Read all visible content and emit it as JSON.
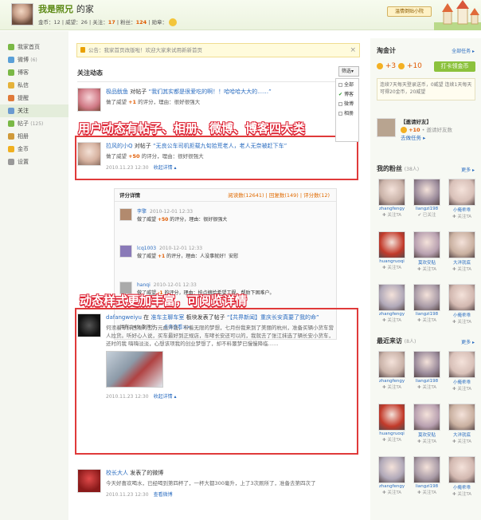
{
  "header": {
    "site_name": "我是照兄",
    "site_suffix": "的家",
    "stats": {
      "gold_label": "金币：",
      "gold": "12",
      "prestige_label": "威望：",
      "prestige": "26",
      "follow_label": "关注：",
      "follow": "17",
      "fans_label": "粉丝：",
      "fans": "124",
      "medal_label": "勋章："
    },
    "new_button": "温情倒贴小院"
  },
  "sidebar": {
    "items": [
      {
        "label": "我家首页",
        "count": "",
        "color": "#7ab846"
      },
      {
        "label": "微博",
        "count": "(6)",
        "color": "#5aa0d8"
      },
      {
        "label": "博客",
        "count": "",
        "color": "#7ab846"
      },
      {
        "label": "私信",
        "count": "",
        "color": "#e5b23a"
      },
      {
        "label": "提醒",
        "count": "",
        "color": "#e07a3a"
      },
      {
        "label": "关注",
        "count": "",
        "color": "#6a9ad0"
      },
      {
        "label": "帖子",
        "count": "(125)",
        "color": "#7ab846"
      },
      {
        "label": "相册",
        "count": "",
        "color": "#d09a3a"
      },
      {
        "label": "金币",
        "count": "",
        "color": "#f0b020"
      },
      {
        "label": "设置",
        "count": "",
        "color": "#999999"
      }
    ]
  },
  "main": {
    "notice": "公告：我家首页改版啦！欢迎大家来试用新新首页",
    "notice_close": "×",
    "section_title": "关注动态",
    "filter": {
      "label": "筛选▾",
      "options": [
        {
          "label": "全部",
          "checked": false
        },
        {
          "label": "博客",
          "checked": true
        },
        {
          "label": "微博",
          "checked": false
        },
        {
          "label": "相册",
          "checked": false
        }
      ]
    },
    "feed": [
      {
        "user": "极品鱿鱼",
        "action": "对帖子",
        "title": "“我们其实都是很爱吃的啊！！哈哈哈大大的……”",
        "sub_pre": "做了威望",
        "score": "+1",
        "sub_post": "的评分，理由：很好很强大"
      },
      {
        "user": "拉风的小Q",
        "action": "对帖子",
        "title": "“无良公车司机拒载九旬拾荒老人，老人无奈被赶下车”",
        "sub_pre": "做了威望",
        "score": "+50",
        "sub_post": "的评分，理由：很好很强大",
        "time": "2010.11.23 12:30",
        "more": "收起详情 ▴"
      }
    ],
    "rating": {
      "title": "评分详情",
      "tabs": "阅读数(12641) | 回复数(149) | 评分数(12)",
      "items": [
        {
          "name": "李擎",
          "time": "2010-12-01 12:33",
          "pre": "做了威望",
          "score": "+50",
          "post": "的评分，理由：很好很强大"
        },
        {
          "name": "lcq1003",
          "time": "2010-12-01 12:33",
          "pre": "做了威望",
          "score": "+1",
          "post": "的评分，理由：人没事就好！安慰"
        },
        {
          "name": "hanqi",
          "time": "2010-12-01 12:33",
          "pre": "做了威望",
          "score": "-1",
          "post": "的评分，理由：拍点摘给希望工程，帮助下困难户。"
        }
      ],
      "footer_pre": "共有 149 条评分，",
      "footer_link": "点击查看>>"
    },
    "post": {
      "user": "dafangweiyu",
      "pre": "在",
      "board": "准车主聊车室",
      "mid": "板块发表了帖子",
      "title": "“【共界新闻】重庆长安真要了我的命”",
      "body": "何须着车抹西凑的五万元血汗钱，带着无限的梦想，七月份我来到了美丽的杭州，准备买辆小货车营人拉货。听好心人说，买车最好到正规店，车哮长安还可以的，我就去了张江抹选了辆长安小货车，还时的我 嗨嗨淡淡，心想该项我的创业梦想了，却不料噩梦已慢慢降临……",
      "time": "2010.11.23 12:30",
      "more": "收起详情 ▴"
    },
    "weibo": {
      "user": "校长大人",
      "action": "发表了的微博",
      "body": "今天好喜欢喝水，已经喝到第四杯了，一杯大都300毫升，上了3次厕所了，准备去第四次了",
      "time": "2010.11.23 12:30",
      "more": "查看微博"
    }
  },
  "annotations": {
    "a1": "用户动态有帖子、相册、微博、博客四大类",
    "a2": "动态样式更加丰富，可阅览详情"
  },
  "right": {
    "coins_title": "淘金计",
    "coins_more": "全部任务 ▸",
    "coin_a": "+3",
    "coin_b": "+10",
    "checkin": "打卡领金币",
    "box1": "连续7天每天登录送币，0威望 连续1天每天可得20金币，20威望",
    "invite_title": "【邀请好友】",
    "invite_reward": "+10",
    "invite_note": "• 邀请好友数",
    "invite_link": "去做任务 ▸",
    "fans_title": "我的粉丝",
    "fans_count": "(38人)",
    "fans_more": "更多 ▸",
    "fans": [
      {
        "n": "zhangfengy",
        "f": "✚ 关注TA"
      },
      {
        "n": "liangzi198",
        "f": "✔ 已关注"
      },
      {
        "n": "小俺乖乖",
        "f": "✚ 关注TA"
      },
      {
        "n": "huangruoqi",
        "f": "✚ 关注TA"
      },
      {
        "n": "莫欢安贴",
        "f": "✚ 关注TA"
      },
      {
        "n": "大洋就底",
        "f": "✚ 关注TA"
      },
      {
        "n": "zhangfengy",
        "f": "✚ 关注TA"
      },
      {
        "n": "liangzi198",
        "f": "✚ 关注TA"
      },
      {
        "n": "小俺乖乖",
        "f": "✚ 关注TA"
      }
    ],
    "visit_title": "最近来访",
    "visit_count": "(8人)",
    "visit_more": "更多 ▸",
    "visitors": [
      {
        "n": "zhangfengy",
        "f": "✚ 关注TA"
      },
      {
        "n": "liangzi198",
        "f": "✚ 关注TA"
      },
      {
        "n": "小俺乖乖",
        "f": "✚ 关注TA"
      },
      {
        "n": "huangruoqi",
        "f": "✚ 关注TA"
      },
      {
        "n": "莫欢安贴",
        "f": "✚ 关注TA"
      },
      {
        "n": "大洋就底",
        "f": "✚ 关注TA"
      },
      {
        "n": "zhangfengy",
        "f": "✚ 关注TA"
      },
      {
        "n": "liangzi198",
        "f": "✚ 关注TA"
      },
      {
        "n": "小俺乖乖",
        "f": "✚ 关注TA"
      }
    ]
  }
}
